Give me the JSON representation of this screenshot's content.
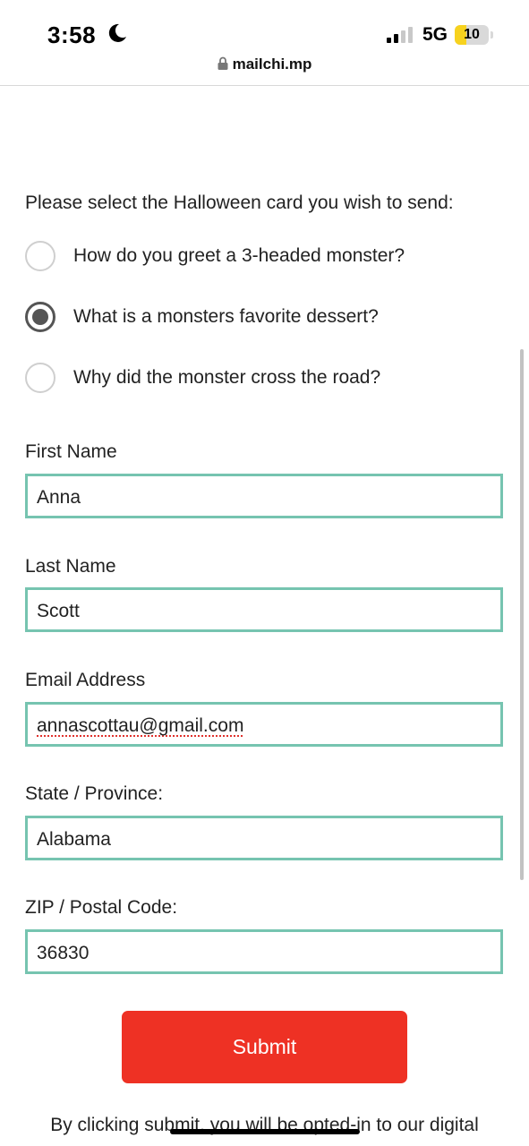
{
  "status_bar": {
    "time": "3:58",
    "network": "5G",
    "battery": "10",
    "battery_level": 0.1,
    "icons": [
      "moon-icon",
      "cellular-signal-icon",
      "battery-icon"
    ]
  },
  "browser": {
    "url": "mailchi.mp",
    "icons": [
      "lock-icon"
    ]
  },
  "form": {
    "card_prompt": "Please select the Halloween card you wish to send:",
    "card_options": [
      {
        "label": "How do you greet a 3-headed monster?",
        "selected": false
      },
      {
        "label": "What is a monsters favorite dessert?",
        "selected": true
      },
      {
        "label": "Why did the monster cross the road?",
        "selected": false
      }
    ],
    "first_name": {
      "label": "First Name",
      "value": "Anna"
    },
    "last_name": {
      "label": "Last Name",
      "value": "Scott"
    },
    "email": {
      "label": "Email Address",
      "value": "annascottau@gmail.com"
    },
    "state": {
      "label": "State / Province:",
      "value": "Alabama"
    },
    "zip": {
      "label": "ZIP / Postal Code:",
      "value": "36830"
    },
    "submit_label": "Submit",
    "disclaimer": "By clicking submit, you will be opted-in to our digital"
  },
  "colors": {
    "field_border": "#76c4b0",
    "submit_bg": "#ee3124",
    "battery_fill": "#f7d21e"
  }
}
